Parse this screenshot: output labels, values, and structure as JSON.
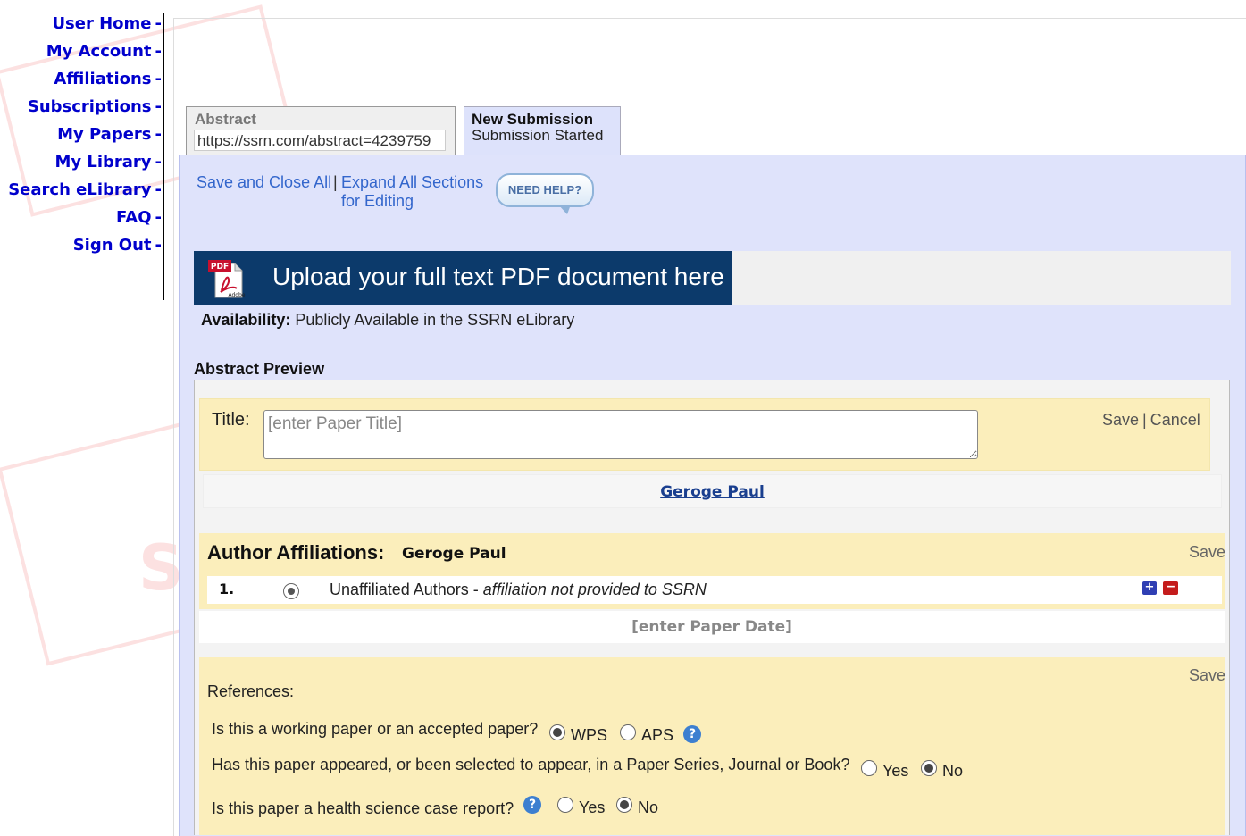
{
  "nav": {
    "items": [
      {
        "label": "User Home"
      },
      {
        "label": "My Account"
      },
      {
        "label": "Affiliations"
      },
      {
        "label": "Subscriptions"
      },
      {
        "label": "My Papers"
      },
      {
        "label": "My Library"
      },
      {
        "label": "Search eLibrary"
      },
      {
        "label": "FAQ"
      },
      {
        "label": "Sign Out"
      }
    ],
    "separator": "-"
  },
  "tabs": {
    "abstract": {
      "title": "Abstract",
      "url": "https://ssrn.com/abstract=4239759"
    },
    "new_submission": {
      "title": "New Submission",
      "status": "Submission Started"
    }
  },
  "toolbar": {
    "save_close_label": "Save and Close All",
    "separator": "|",
    "expand_all_label": "Expand All Sections for Editing",
    "need_help_label": "NEED HELP?"
  },
  "upload": {
    "label": "Upload your full text PDF document here",
    "icon": "pdf-adobe-icon",
    "icon_badge": "PDF",
    "icon_brand": "Adobe"
  },
  "availability": {
    "label": "Availability:",
    "value": "Publicly Available in the SSRN eLibrary"
  },
  "abstract_preview": {
    "label": "Abstract Preview",
    "title_label": "Title:",
    "title_value": "",
    "title_placeholder": "[enter Paper Title]",
    "save_label": "Save",
    "cancel_label": "Cancel",
    "author_name": "Geroge Paul"
  },
  "affiliations": {
    "heading": "Author Affiliations:",
    "author_name": "Geroge Paul",
    "save_label": "Save",
    "items": [
      {
        "number": "1.",
        "name": "Unaffiliated Authors",
        "note": "affiliation not provided to SSRN",
        "selected": true
      }
    ]
  },
  "paper_date": {
    "placeholder": "[enter Paper Date]"
  },
  "references": {
    "label": "References:",
    "save_label": "Save",
    "questions": [
      {
        "text": "Is this a working paper or an accepted paper?",
        "options": [
          "WPS",
          "APS"
        ],
        "selected": "WPS",
        "help": true
      },
      {
        "text": "Has this paper appeared, or been selected to appear, in a Paper Series, Journal or Book?",
        "options": [
          "Yes",
          "No"
        ],
        "selected": "No",
        "help": false
      },
      {
        "text": "Is this paper a health science case report?",
        "options": [
          "Yes",
          "No"
        ],
        "selected": "No",
        "help": true
      }
    ]
  },
  "colors": {
    "nav_link": "#0000cc",
    "panel_bg": "#dfe3fb",
    "upload_bg": "#0c3a6b",
    "section_bg": "#fbeebb",
    "link_blue": "#3366cc",
    "help_blue": "#3d7fd0"
  }
}
